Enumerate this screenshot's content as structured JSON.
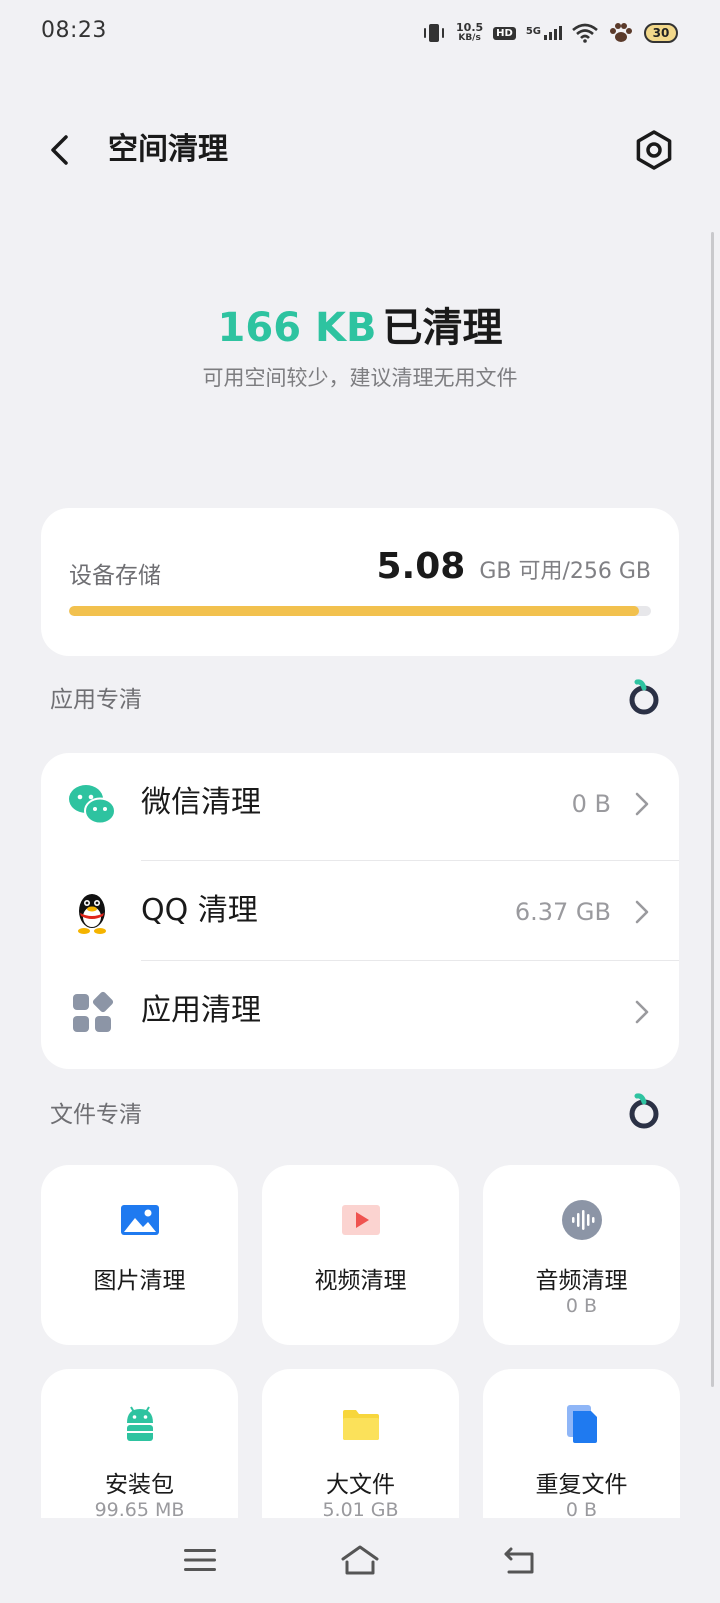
{
  "status_bar": {
    "time": "08:23",
    "net_speed_value": "10.5",
    "net_speed_unit": "KB/s",
    "hd_label": "HD",
    "network_label": "5G",
    "battery_level": "30"
  },
  "header": {
    "title": "空间清理"
  },
  "hero": {
    "amount": "166 KB",
    "label": "已清理",
    "subtitle": "可用空间较少，建议清理无用文件"
  },
  "storage": {
    "label": "设备存储",
    "free_value": "5.08",
    "unit_text": "GB 可用/256 GB",
    "used_fraction": 0.98
  },
  "app_section": {
    "title": "应用专清",
    "items": [
      {
        "label": "微信清理",
        "size": "0 B",
        "icon": "wechat-icon"
      },
      {
        "label": "QQ 清理",
        "size": "6.37 GB",
        "icon": "qq-icon"
      },
      {
        "label": "应用清理",
        "size": "",
        "icon": "apps-icon"
      }
    ]
  },
  "file_section": {
    "title": "文件专清",
    "tiles": [
      {
        "label": "图片清理",
        "sub": "",
        "icon": "image-icon"
      },
      {
        "label": "视频清理",
        "sub": "",
        "icon": "video-icon"
      },
      {
        "label": "音频清理",
        "sub": "0 B",
        "icon": "audio-icon"
      },
      {
        "label": "安装包",
        "sub": "99.65 MB",
        "icon": "android-icon"
      },
      {
        "label": "大文件",
        "sub": "5.01 GB",
        "icon": "folder-icon"
      },
      {
        "label": "重复文件",
        "sub": "0 B",
        "icon": "duplicate-file-icon"
      }
    ]
  },
  "colors": {
    "accent_green": "#2ec3a0",
    "storage_bar": "#f2c14e",
    "background": "#f1f1f4"
  }
}
